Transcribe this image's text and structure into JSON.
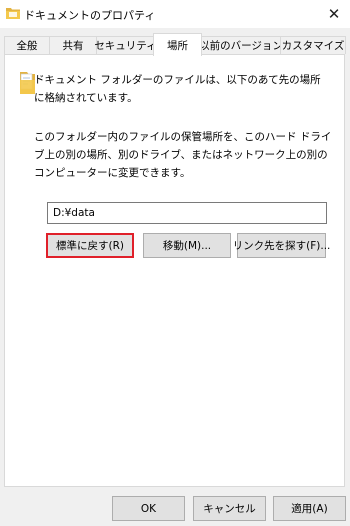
{
  "window": {
    "title": "ドキュメントのプロパティ",
    "close_glyph": "✕"
  },
  "tabs": [
    {
      "label": "全般"
    },
    {
      "label": "共有"
    },
    {
      "label": "セキュリティ"
    },
    {
      "label": "場所",
      "active": true
    },
    {
      "label": "以前のバージョン"
    },
    {
      "label": "カスタマイズ"
    }
  ],
  "location": {
    "description1": "ドキュメント フォルダーのファイルは、以下のあて先の場所に格納されています。",
    "description2": "このフォルダー内のファイルの保管場所を、このハード ドライブ上の別の場所、別のドライブ、またはネットワーク上の別のコンピューターに変更できます。",
    "path_value": "D:¥data",
    "restore_default_label": "標準に戻す(R)",
    "move_label": "移動(M)...",
    "find_target_label": "リンク先を探す(F)..."
  },
  "footer": {
    "ok_label": "OK",
    "cancel_label": "キャンセル",
    "apply_label": "適用(A)"
  },
  "colors": {
    "highlight_border": "#e0202a",
    "folder_yellow": "#f4c94c"
  },
  "icons": {
    "app": "folder-documents-icon",
    "content": "folder-documents-icon",
    "close": "close-icon"
  }
}
